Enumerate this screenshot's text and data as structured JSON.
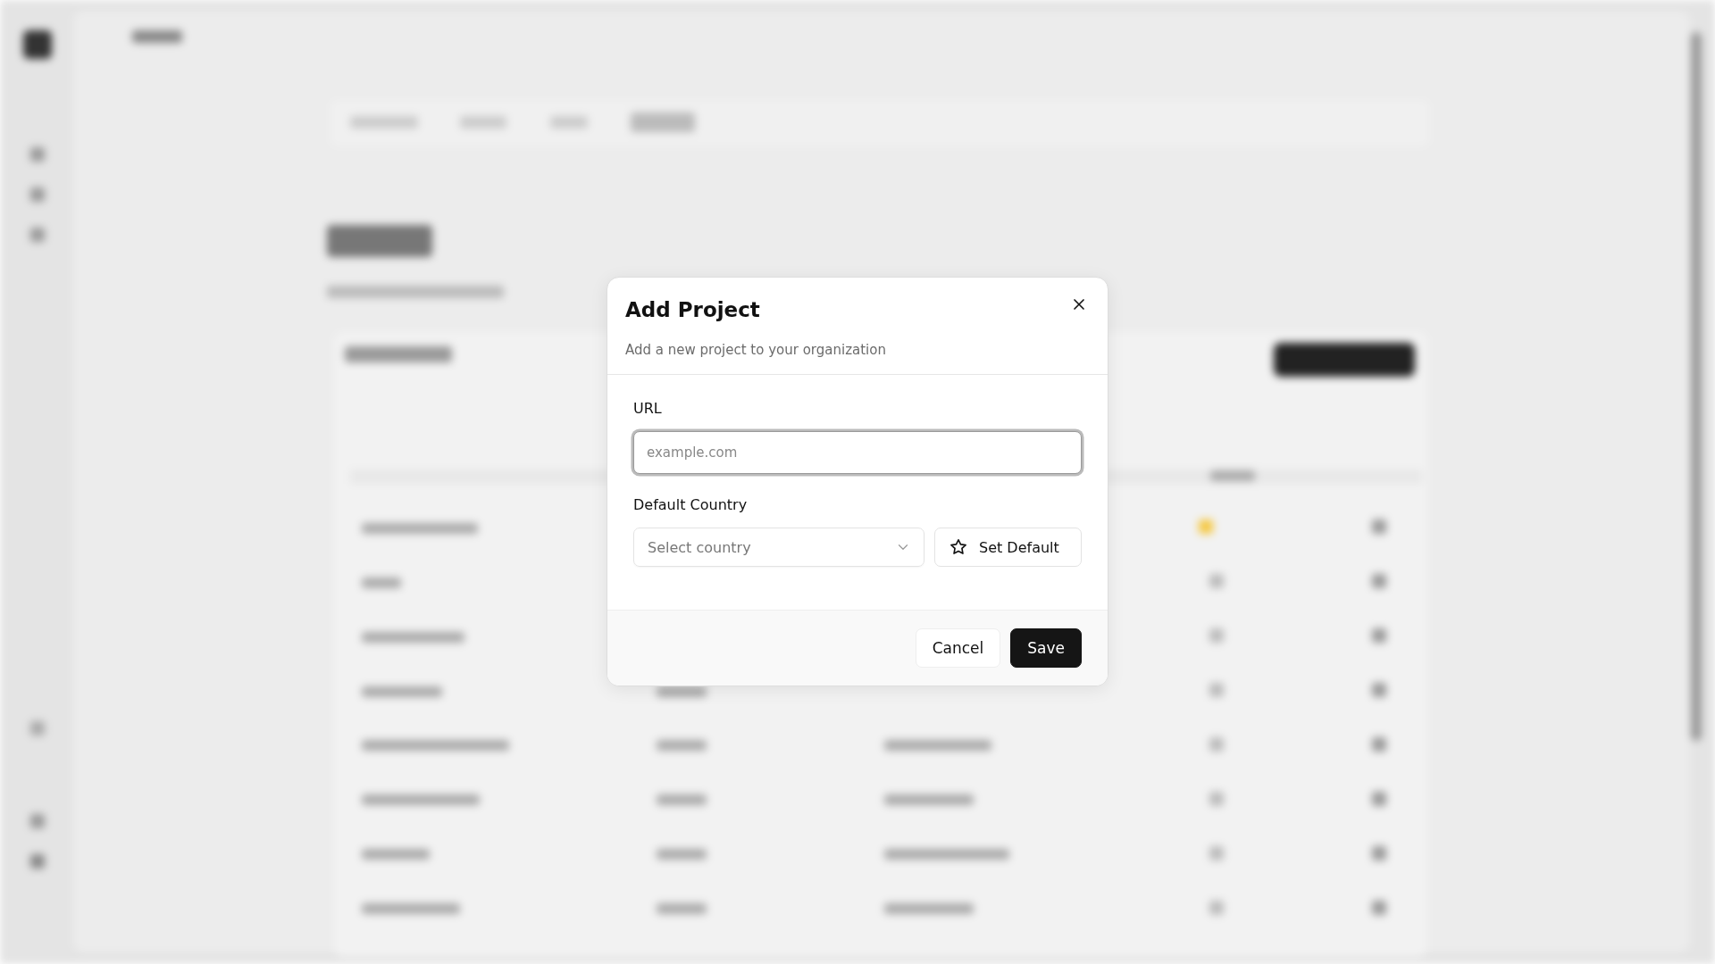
{
  "dialog": {
    "title": "Add Project",
    "description": "Add a new project to your organization",
    "fields": [
      {
        "kind": "text",
        "label": "URL",
        "placeholder": "example.com",
        "focused": true
      },
      {
        "kind": "select",
        "label": "Default Country",
        "placeholder": "Select country",
        "action": "Set Default"
      }
    ],
    "buttons": [
      {
        "label": "Cancel",
        "primary": false
      },
      {
        "label": "Save",
        "primary": true
      }
    ]
  }
}
